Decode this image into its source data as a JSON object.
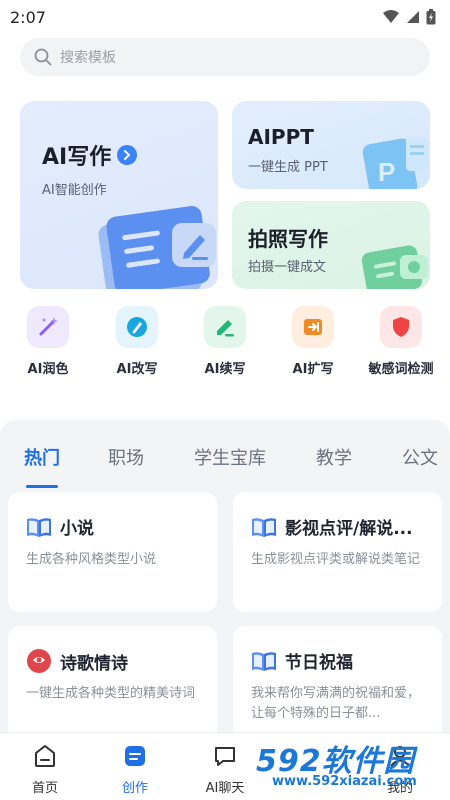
{
  "status": {
    "time": "2:07"
  },
  "search": {
    "placeholder": "搜索模板"
  },
  "cards": {
    "ai_write": {
      "title": "AI写作",
      "subtitle": "AI智能创作"
    },
    "ppt": {
      "title": "AIPPT",
      "subtitle": "一键生成 PPT"
    },
    "photo": {
      "title": "拍照写作",
      "subtitle": "拍摄一键成文"
    }
  },
  "tools": [
    {
      "label": "AI润色",
      "icon": "magic-wand-icon",
      "color": "#8b5cf6",
      "bg": "#efe9fd"
    },
    {
      "label": "AI改写",
      "icon": "pen-circle-icon",
      "color": "#1aa7e0",
      "bg": "#e3f4fb"
    },
    {
      "label": "AI续写",
      "icon": "pencil-icon",
      "color": "#22b573",
      "bg": "#e2f6ec"
    },
    {
      "label": "AI扩写",
      "icon": "expand-icon",
      "color": "#f08a24",
      "bg": "#fdeee0"
    },
    {
      "label": "敏感词检测",
      "icon": "shield-icon",
      "color": "#ef4444",
      "bg": "#fde6e6"
    }
  ],
  "tabs": [
    "热门",
    "职场",
    "学生宝库",
    "教学",
    "公文"
  ],
  "templates": [
    {
      "title": "小说",
      "desc": "生成各种风格类型小说",
      "icon": "book-icon"
    },
    {
      "title": "影视点评/解说...",
      "desc": "生成影视点评类或解说类笔记",
      "icon": "book-icon"
    },
    {
      "title": "诗歌情诗",
      "desc": "一键生成各种类型的精美诗词",
      "icon": "poem-icon"
    },
    {
      "title": "节日祝福",
      "desc": "我来帮你写满满的祝福和爱，让每个特殊的日子都...",
      "icon": "book-icon"
    }
  ],
  "nav": [
    {
      "label": "首页",
      "icon": "home-icon"
    },
    {
      "label": "创作",
      "icon": "create-icon"
    },
    {
      "label": "AI聊天",
      "icon": "chat-icon"
    },
    {
      "label": "我的",
      "icon": "profile-icon"
    }
  ],
  "watermark": {
    "big": "592软件园",
    "small": "www.592xiazai.com"
  },
  "colors": {
    "accent": "#1f6fe5",
    "panel_bg": "#f3f4f6"
  }
}
